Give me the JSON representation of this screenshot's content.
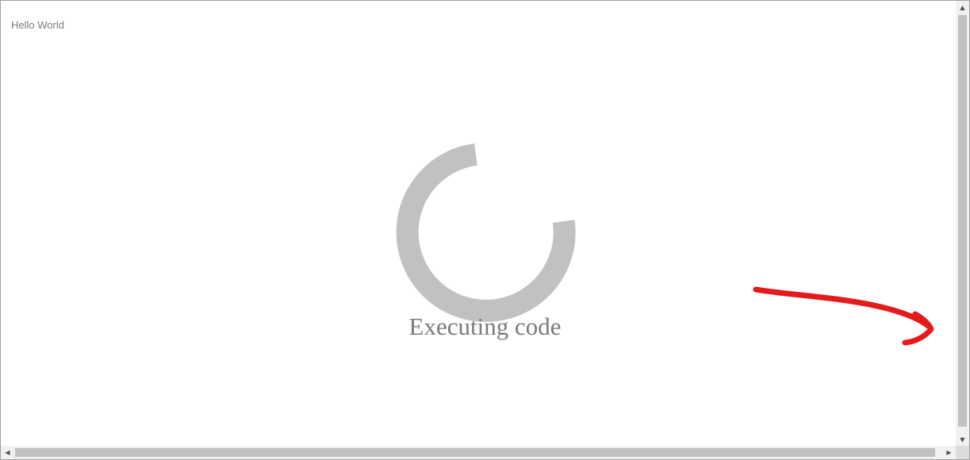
{
  "output": {
    "text": "Hello World"
  },
  "loader": {
    "status_text": "Executing code",
    "spinner_color": "#c1c1c1",
    "text_color": "#7a7a7a"
  },
  "annotation": {
    "color": "#e31b1b",
    "icon": "red-arrow-icon"
  },
  "scrollbars": {
    "up_icon": "▲",
    "down_icon": "▼",
    "left_icon": "◀",
    "right_icon": "▶"
  }
}
